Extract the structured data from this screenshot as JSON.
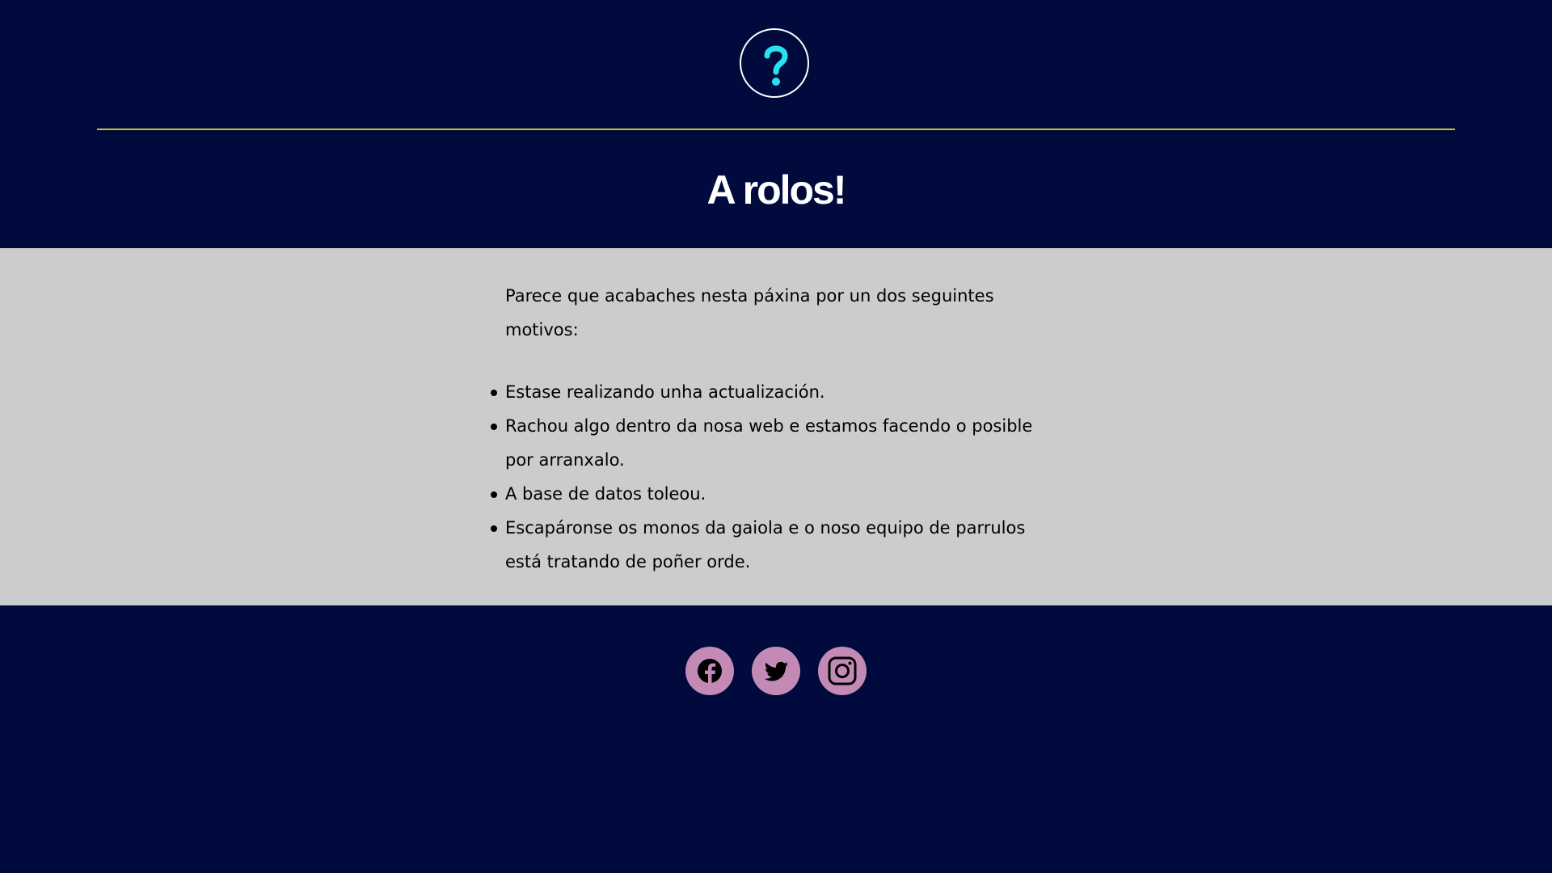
{
  "header": {
    "logo_icon": "question-mark-icon",
    "title": "A rolos!"
  },
  "content": {
    "intro": "Parece que acabaches nesta páxina por un dos seguintes motivos:",
    "reasons": [
      "Estase realizando unha actualización.",
      "Rachou algo dentro da nosa web e estamos facendo o posible por arranxalo.",
      "A base de datos toleou.",
      "Escapáronse os monos da gaiola e o noso equipo de parrulos está tratando de poñer orde."
    ]
  },
  "footer": {
    "social": [
      {
        "icon": "facebook-icon"
      },
      {
        "icon": "twitter-icon"
      },
      {
        "icon": "instagram-icon"
      }
    ]
  },
  "colors": {
    "background": "#000a3d",
    "content_background": "#cccccc",
    "divider": "#c8c62a",
    "question_mark": "#29e0f0",
    "social_button": "#c48ab6"
  }
}
